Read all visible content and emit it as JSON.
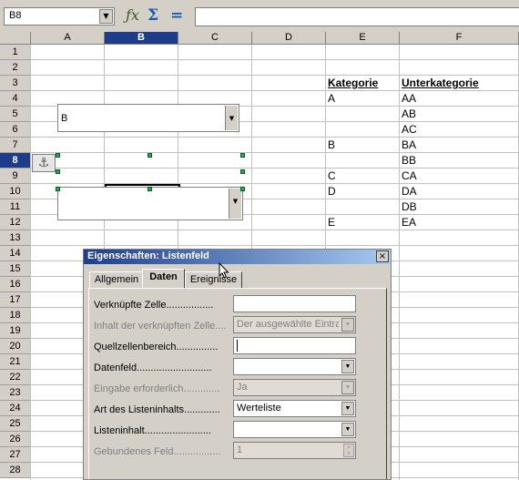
{
  "formula_bar": {
    "cell_reference": "B8",
    "icons": [
      "function-wizard-icon",
      "sum-icon",
      "equals-icon"
    ],
    "formula_value": ""
  },
  "grid": {
    "columns": [
      "A",
      "B",
      "C",
      "D",
      "E",
      "F"
    ],
    "selected_column": "B",
    "rows": [
      "1",
      "2",
      "3",
      "4",
      "5",
      "6",
      "7",
      "8",
      "9",
      "10",
      "11",
      "12",
      "13",
      "14",
      "15",
      "16",
      "17",
      "18",
      "19",
      "20",
      "21",
      "22",
      "23",
      "24",
      "25",
      "26",
      "27",
      "28"
    ],
    "selected_row": "8",
    "cells": {
      "E3": "Kategorie",
      "F3": "Unterkategorie",
      "E4": "A",
      "F4": "AA",
      "F5": "AB",
      "F6": "AC",
      "E7": "B",
      "F7": "BA",
      "F8": "BB",
      "E9": "C",
      "F9": "CA",
      "E10": "D",
      "F10": "DA",
      "F11": "DB",
      "E12": "E",
      "F12": "EA"
    },
    "listbox_1_value": "B",
    "anchor_icon": "anchor-icon"
  },
  "dialog": {
    "title": "Eigenschaften: Listenfeld",
    "close_label": "×",
    "tabs": [
      {
        "label": "Allgemein",
        "active": false
      },
      {
        "label": "Daten",
        "active": true
      },
      {
        "label": "Ereignisse",
        "active": false
      }
    ],
    "properties": [
      {
        "label": "Verknüpfte Zelle.................",
        "value": "",
        "type": "text",
        "enabled": true
      },
      {
        "label": "Inhalt der verknüpften Zelle....",
        "value": "Der ausgewählte Eintrag",
        "type": "dropdown",
        "enabled": false
      },
      {
        "label": "Quellzellenbereich...............",
        "value": "",
        "type": "text-focused",
        "enabled": true
      },
      {
        "label": "Datenfeld...........................",
        "value": "",
        "type": "dropdown",
        "enabled": true
      },
      {
        "label": "Eingabe erforderlich.............",
        "value": "Ja",
        "type": "dropdown",
        "enabled": false
      },
      {
        "label": "Art des Listeninhalts.............",
        "value": "Werteliste",
        "type": "dropdown",
        "enabled": true
      },
      {
        "label": "Listeninhalt........................",
        "value": "",
        "type": "dropdown",
        "enabled": true
      },
      {
        "label": "Gebundenes Feld.................",
        "value": "1",
        "type": "spinner",
        "enabled": false
      }
    ]
  },
  "colors": {
    "chrome": "#d4d0c8",
    "selection": "#1d3d8a",
    "handle": "#22b14c",
    "title_gradient_end": "#a6caf0"
  }
}
